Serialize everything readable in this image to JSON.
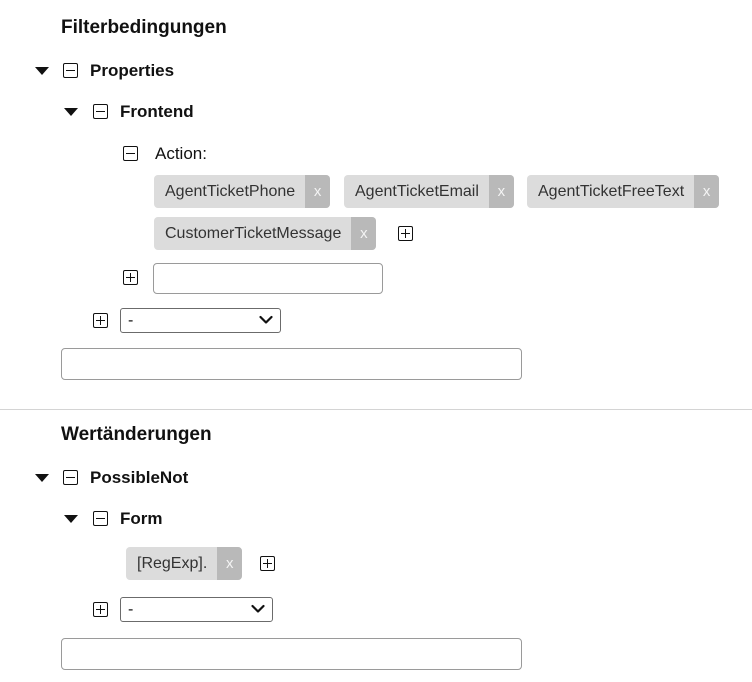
{
  "filter": {
    "title": "Filterbedingungen",
    "root_label": "Properties",
    "child_label": "Frontend",
    "action_label": "Action:",
    "chips": [
      "AgentTicketPhone",
      "AgentTicketEmail",
      "AgentTicketFreeText",
      "CustomerTicketMessage"
    ],
    "chip_remove": "x",
    "add_value_input": "",
    "select_value": "-",
    "new_filter_input": ""
  },
  "changes": {
    "title": "Wertänderungen",
    "root_label": "PossibleNot",
    "child_label": "Form",
    "chips": [
      "[RegExp]."
    ],
    "chip_remove": "x",
    "select_value": "-",
    "new_change_input": ""
  }
}
